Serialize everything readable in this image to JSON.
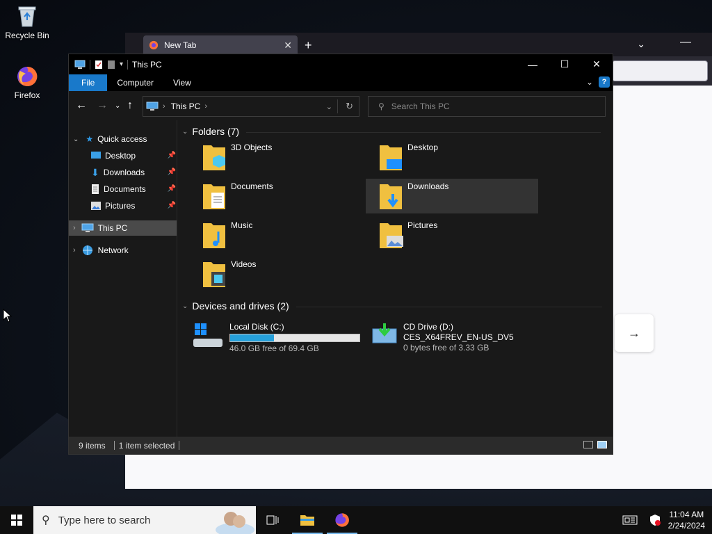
{
  "desktop": {
    "icons": [
      {
        "label": "Recycle Bin",
        "icon": "recycle-bin-icon"
      },
      {
        "label": "Firefox",
        "icon": "firefox-icon"
      }
    ]
  },
  "firefox": {
    "tab_title": "New Tab",
    "new_tab": "+",
    "close_tab": "✕",
    "next_arrow": "→"
  },
  "explorer": {
    "title": "This PC",
    "ribbon_tabs": [
      "File",
      "Computer",
      "View"
    ],
    "help": "?",
    "address": {
      "crumb": "This PC"
    },
    "search_placeholder": "Search This PC",
    "nav": {
      "quick_access": "Quick access",
      "desktop": "Desktop",
      "downloads": "Downloads",
      "documents": "Documents",
      "pictures": "Pictures",
      "this_pc": "This PC",
      "network": "Network"
    },
    "folders_header": "Folders (7)",
    "folders": [
      "3D Objects",
      "Desktop",
      "Documents",
      "Downloads",
      "Music",
      "Pictures",
      "Videos"
    ],
    "selected_folder": "Downloads",
    "drives_header": "Devices and drives (2)",
    "drives": [
      {
        "name": "Local Disk (C:)",
        "free": "46.0 GB free of 69.4 GB",
        "used_fraction": 0.337
      },
      {
        "name": "CD Drive (D:)",
        "label": "CES_X64FREV_EN-US_DV5",
        "free": "0 bytes free of 3.33 GB"
      }
    ],
    "status": {
      "items": "9 items",
      "selected": "1 item selected"
    }
  },
  "taskbar": {
    "search_placeholder": "Type here to search",
    "time": "11:04 AM",
    "date": "2/24/2024"
  },
  "colors": {
    "accent": "#1979ca",
    "drive_bar": "#26a0da",
    "folder": "#f0c040"
  }
}
